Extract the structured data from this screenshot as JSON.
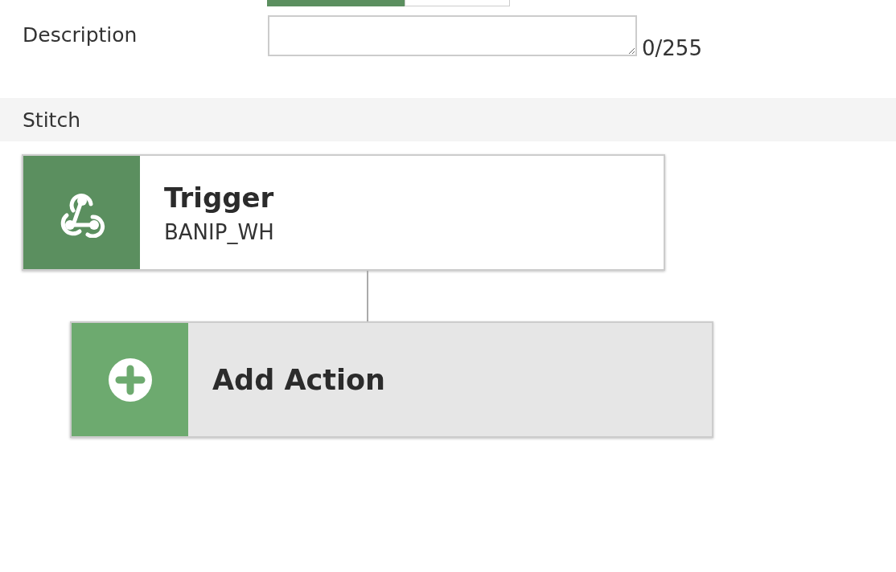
{
  "toggle": [
    {
      "selected": true
    },
    {
      "selected": false
    }
  ],
  "description": {
    "label": "Description",
    "counter": "0/255"
  },
  "section": {
    "title": "Stitch"
  },
  "trigger": {
    "title": "Trigger",
    "subtitle": "BANIP_WH"
  },
  "add_action": {
    "label": "Add Action"
  }
}
